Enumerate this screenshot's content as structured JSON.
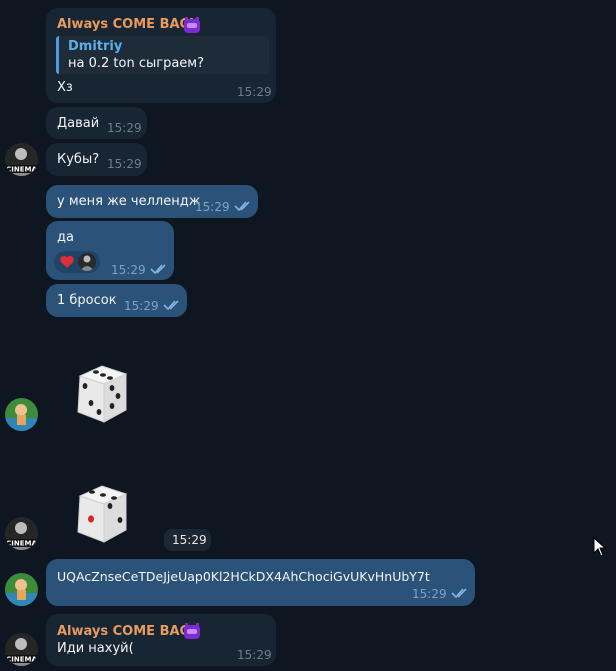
{
  "messages": {
    "m1": {
      "sender": "Always COME BACK",
      "reply_name": "Dmitriy",
      "reply_text": "на 0.2 ton сыграем?",
      "text": "Хз",
      "time": "15:29"
    },
    "m2": {
      "text": "Давай",
      "time": "15:29"
    },
    "m3": {
      "text": "Кубы?",
      "time": "15:29"
    },
    "m4": {
      "text": "у меня же челлендж",
      "time": "15:29"
    },
    "m5": {
      "text": "да",
      "time": "15:29"
    },
    "m6": {
      "text": "1 бросок",
      "time": "15:29"
    },
    "m7": {
      "time": "15:29"
    },
    "m8": {
      "text": "UQAcZnseCeTDeJjeUap0Kl2HCkDX4AhChociGvUKvHnUbY7t",
      "time": "15:29"
    },
    "m9": {
      "sender": "Always COME BACK",
      "text": "Иди нахуй(",
      "time": "15:29"
    }
  },
  "avatar_label": "CINEMA",
  "dice": {
    "first_value": 6,
    "second_value": 1
  },
  "colors": {
    "background": "#0e1621",
    "incoming": "#182533",
    "outgoing": "#2b5278",
    "sender_name": "#e89b5f",
    "reply_accent": "#4c9ce2",
    "read_ticks": "#7fb7ea"
  },
  "icons": [
    "badge-icon",
    "heart-icon",
    "read-ticks-icon",
    "dice-icon",
    "mouse-cursor-icon"
  ]
}
